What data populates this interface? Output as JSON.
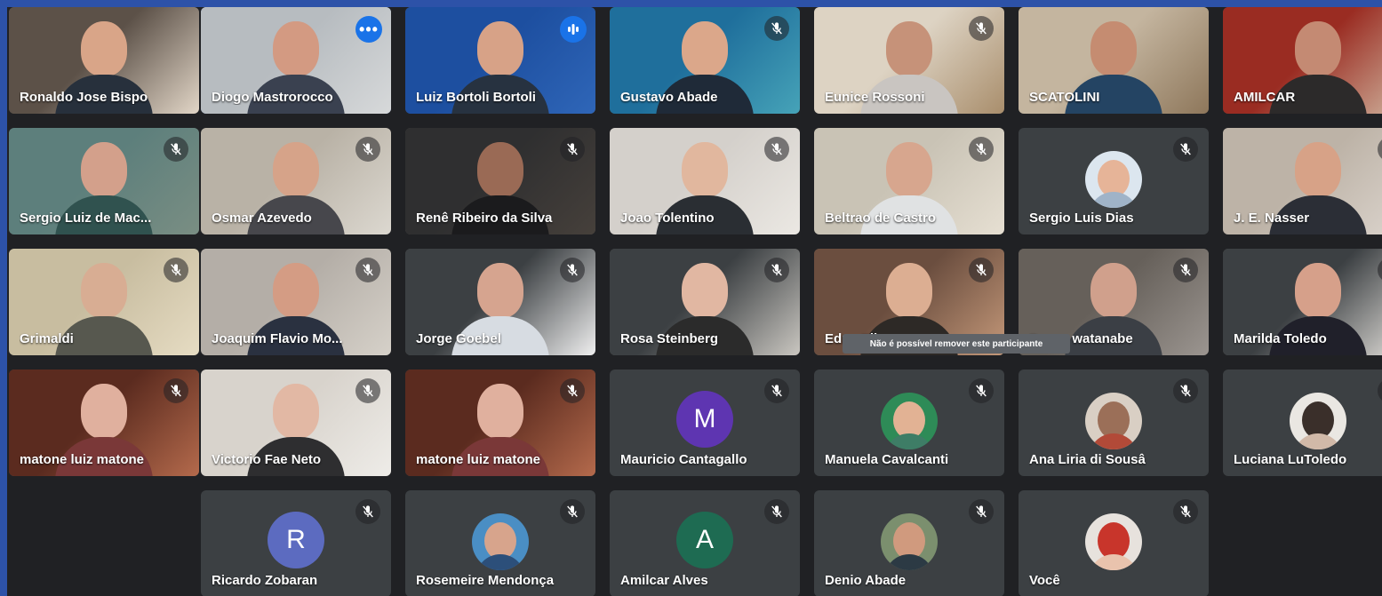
{
  "tooltip": "Não é possível remover este participante",
  "colors": {
    "outer_border": "#2d52a8",
    "grid_background": "#202124",
    "tile_background": "#3c4043",
    "active_outline": "#8ab4f8",
    "button_blue": "#1a73e8"
  },
  "participants": [
    {
      "name": "Ronaldo Jose Bispo",
      "kind": "video",
      "muted": false,
      "icons": []
    },
    {
      "name": "Diogo Mastrorocco",
      "kind": "video",
      "muted": false,
      "icons": [
        "more-options-icon"
      ],
      "active": true
    },
    {
      "name": "Luiz Bortoli Bortoli",
      "kind": "video",
      "muted": false,
      "icons": [
        "speaking-indicator-icon"
      ]
    },
    {
      "name": "Gustavo Abade",
      "kind": "video",
      "muted": true
    },
    {
      "name": "Eunice Rossoni",
      "kind": "video",
      "muted": true
    },
    {
      "name": "SCATOLINI",
      "kind": "video",
      "muted": false
    },
    {
      "name": "AMILCAR",
      "kind": "video",
      "muted": false
    },
    {
      "name": "Sergio Luiz de Mac...",
      "kind": "video",
      "muted": true
    },
    {
      "name": "Osmar Azevedo",
      "kind": "video",
      "muted": true
    },
    {
      "name": "Renê Ribeiro da Silva",
      "kind": "video",
      "muted": true
    },
    {
      "name": "Joao Tolentino",
      "kind": "video",
      "muted": true
    },
    {
      "name": "Beltrao de Castro",
      "kind": "video",
      "muted": true
    },
    {
      "name": "Sergio Luis Dias",
      "kind": "photo",
      "muted": true
    },
    {
      "name": "J. E. Nasser",
      "kind": "video",
      "muted": true
    },
    {
      "name": "Grimaldi",
      "kind": "video",
      "muted": true
    },
    {
      "name": "Joaquim Flavio Mo...",
      "kind": "video",
      "muted": true
    },
    {
      "name": "Jorge Goebel",
      "kind": "video",
      "muted": true
    },
    {
      "name": "Rosa Steinberg",
      "kind": "video",
      "muted": true
    },
    {
      "name": "Edna Elias",
      "kind": "video",
      "muted": true
    },
    {
      "name": "Bruno watanabe",
      "kind": "video",
      "muted": true
    },
    {
      "name": "Marilda Toledo",
      "kind": "video",
      "muted": true
    },
    {
      "name": "matone luiz matone",
      "kind": "video",
      "muted": true
    },
    {
      "name": "Victorio Fae Neto",
      "kind": "video",
      "muted": true
    },
    {
      "name": "matone luiz matone",
      "kind": "video",
      "muted": true
    },
    {
      "name": "Mauricio Cantagallo",
      "kind": "letter",
      "letter": "M",
      "avatar_color": "#5e35b1",
      "muted": true
    },
    {
      "name": "Manuela Cavalcanti",
      "kind": "photo",
      "muted": true
    },
    {
      "name": "Ana Liria di Sousâ",
      "kind": "photo",
      "muted": true
    },
    {
      "name": "Luciana LuToledo",
      "kind": "photo",
      "muted": true
    },
    {
      "name": "Ricardo Zobaran",
      "kind": "letter",
      "letter": "R",
      "avatar_color": "#5c6bc0",
      "muted": true
    },
    {
      "name": "Rosemeire Mendonça",
      "kind": "photo",
      "muted": true
    },
    {
      "name": "Amilcar Alves",
      "kind": "letter",
      "letter": "A",
      "avatar_color": "#1e6b52",
      "muted": true
    },
    {
      "name": "Denio Abade",
      "kind": "photo",
      "muted": true
    },
    {
      "name": "Você",
      "kind": "photo",
      "muted": true
    }
  ]
}
